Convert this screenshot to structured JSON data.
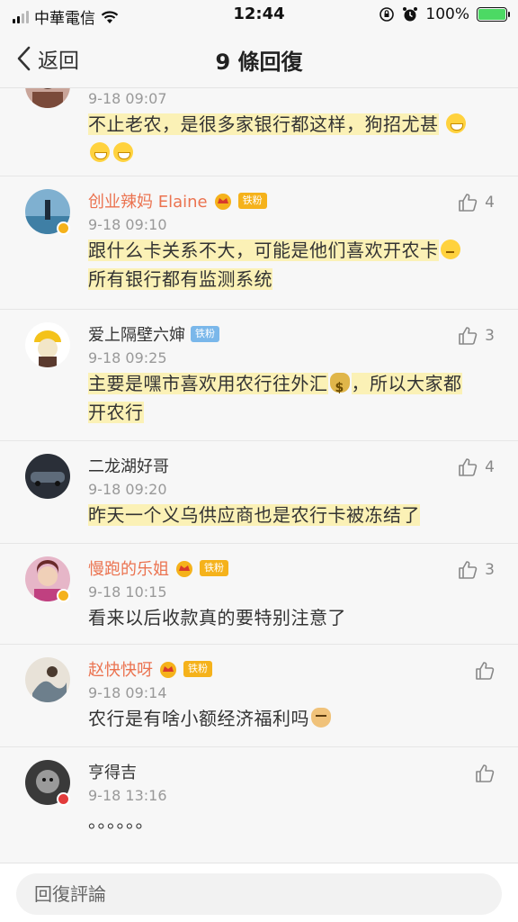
{
  "status_bar": {
    "carrier": "中華電信",
    "time": "12:44",
    "battery": "100%",
    "battery_level": 1.0
  },
  "nav": {
    "back_label": "返回",
    "title": "9 條回復"
  },
  "comments": [
    {
      "username": "",
      "date": "9-18 09:07",
      "text": "不止老农，是很多家银行都这样，狗招尤甚",
      "likes": ""
    },
    {
      "username": "创业辣妈 Elaine",
      "badge": "铁粉",
      "date": "9-18 09:10",
      "text_line1": "跟什么卡关系不大，可能是他们喜欢开农卡",
      "text_line2": "所有银行都有监测系统",
      "likes": "4"
    },
    {
      "username": "爱上隔壁六婶",
      "badge": "铁粉",
      "date": "9-18 09:25",
      "text_line1": "主要是嘿市喜欢用农行往外汇",
      "text_line1b": "，所以大家都",
      "text_line2": "开农行",
      "likes": "3"
    },
    {
      "username": "二龙湖好哥",
      "date": "9-18 09:20",
      "text": "昨天一个义乌供应商也是农行卡被冻结了",
      "likes": "4"
    },
    {
      "username": "慢跑的乐姐",
      "badge": "铁粉",
      "date": "9-18 10:15",
      "text": "看来以后收款真的要特别注意了",
      "likes": "3"
    },
    {
      "username": "赵快快呀",
      "badge": "铁粉",
      "date": "9-18 09:14",
      "text": "农行是有啥小额经济福利吗",
      "likes": ""
    },
    {
      "username": "亨得吉",
      "date": "9-18 13:16",
      "text": "。。。。。。",
      "likes": ""
    }
  ],
  "bottom": {
    "reply_placeholder": "回復評論"
  },
  "colors": {
    "accent": "#eb7350",
    "fan_gold": "#f5b21b",
    "fan_blue": "#7ab7ea",
    "highlight": "#ffec82"
  }
}
